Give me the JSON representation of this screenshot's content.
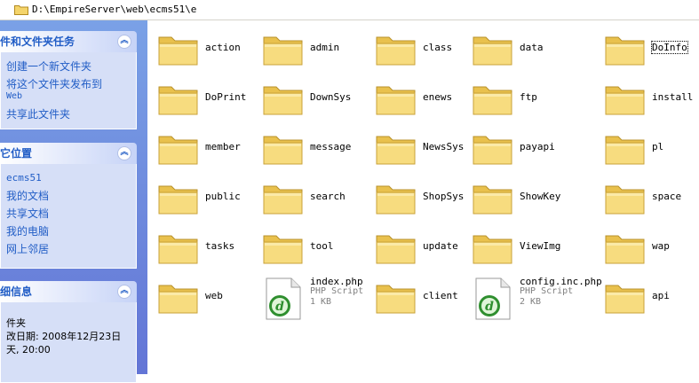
{
  "address": {
    "path": "D:\\EmpireServer\\web\\ecms51\\e"
  },
  "sidebar": {
    "tasks": {
      "title": "件和文件夹任务",
      "links": [
        "创建一个新文件夹",
        "将这个文件夹发布到",
        "Web",
        "共享此文件夹"
      ]
    },
    "places": {
      "title": "它位置",
      "links": [
        "ecms51",
        "我的文档",
        "共享文档",
        "我的电脑",
        "网上邻居"
      ]
    },
    "details": {
      "title": "细信息",
      "lines": [
        "件夹",
        "改日期: 2008年12月23日",
        "天, 20:00"
      ]
    }
  },
  "items": [
    {
      "name": "action",
      "type": "folder"
    },
    {
      "name": "admin",
      "type": "folder"
    },
    {
      "name": "class",
      "type": "folder"
    },
    {
      "name": "data",
      "type": "folder"
    },
    {
      "name": "DoInfo",
      "type": "folder"
    },
    {
      "name": "DoPrint",
      "type": "folder"
    },
    {
      "name": "DownSys",
      "type": "folder"
    },
    {
      "name": "enews",
      "type": "folder"
    },
    {
      "name": "ftp",
      "type": "folder"
    },
    {
      "name": "install",
      "type": "folder"
    },
    {
      "name": "member",
      "type": "folder"
    },
    {
      "name": "message",
      "type": "folder"
    },
    {
      "name": "NewsSys",
      "type": "folder"
    },
    {
      "name": "payapi",
      "type": "folder"
    },
    {
      "name": "pl",
      "type": "folder"
    },
    {
      "name": "public",
      "type": "folder"
    },
    {
      "name": "search",
      "type": "folder"
    },
    {
      "name": "ShopSys",
      "type": "folder"
    },
    {
      "name": "ShowKey",
      "type": "folder"
    },
    {
      "name": "space",
      "type": "folder"
    },
    {
      "name": "tasks",
      "type": "folder"
    },
    {
      "name": "tool",
      "type": "folder"
    },
    {
      "name": "update",
      "type": "folder"
    },
    {
      "name": "ViewImg",
      "type": "folder"
    },
    {
      "name": "wap",
      "type": "folder"
    },
    {
      "name": "web",
      "type": "folder"
    },
    {
      "name": "index.php",
      "type": "file",
      "kind": "PHP Script",
      "size": "1 KB"
    },
    {
      "name": "client",
      "type": "folder"
    },
    {
      "name": "config.inc.php",
      "type": "file",
      "kind": "PHP Script",
      "size": "2 KB"
    },
    {
      "name": "api",
      "type": "folder"
    }
  ],
  "colors": {
    "sidebar_bg": "#6f8be0",
    "link": "#215dc6",
    "folder": "#f4d46a"
  }
}
